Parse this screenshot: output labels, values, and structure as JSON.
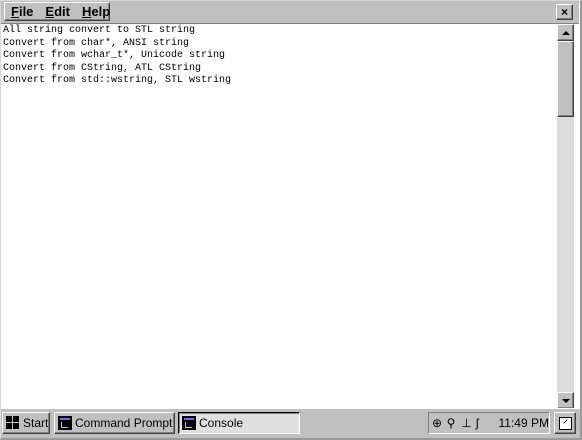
{
  "menu": {
    "items": [
      "File",
      "Edit",
      "Help"
    ],
    "close_symbol": "×"
  },
  "console": {
    "lines": [
      "All string convert to STL string",
      "Convert from char*, ANSI string",
      "Convert from wchar_t*, Unicode string",
      "Convert from CString, ATL CString",
      "Convert from std::wstring, STL wstring"
    ]
  },
  "taskbar": {
    "start_label": "Start",
    "buttons": [
      {
        "label": "Command Prompt",
        "icon": "console-app-icon"
      },
      {
        "label": "Console",
        "icon": "console-app-icon",
        "active": true
      }
    ],
    "tray_icons": [
      "network-icon",
      "connection-icon",
      "usb-icon",
      "power-icon"
    ],
    "clock": "11:49 PM",
    "desktop_icon": "show-desktop-icon"
  },
  "colors": {
    "chrome": "#c0c0c0",
    "window_bg": "#ffffff",
    "text": "#000000"
  }
}
